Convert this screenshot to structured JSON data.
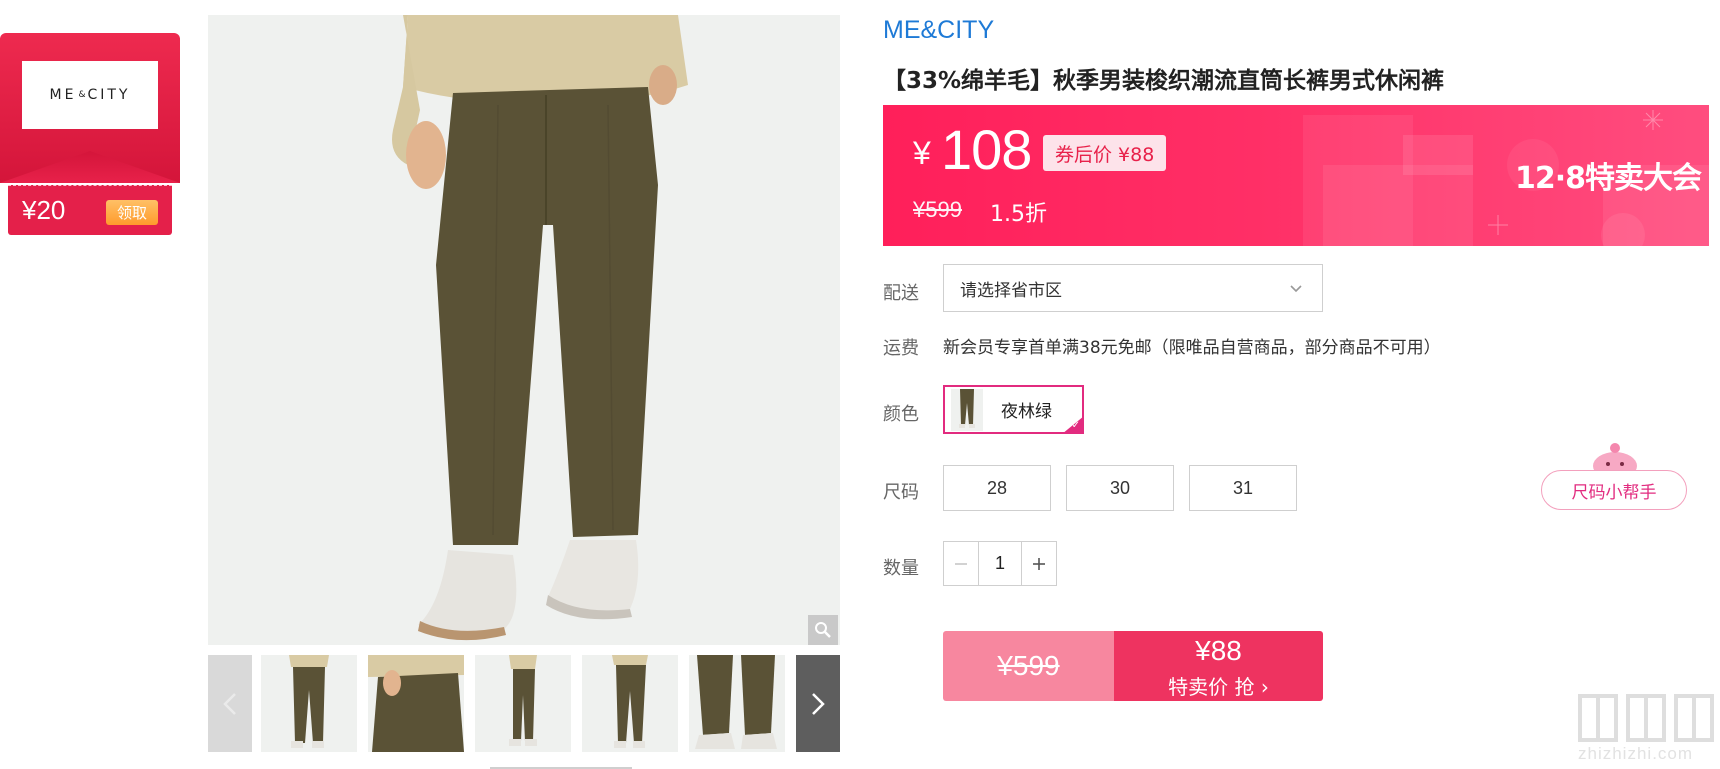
{
  "coupon": {
    "logo_text": "ME & CITY",
    "amount": "¥20",
    "claim_label": "领取"
  },
  "gallery": {
    "main_alt": "olive straight-leg trousers on model",
    "thumb_count": 6
  },
  "product": {
    "brand": "ME&CITY",
    "title": "【33%绵羊毛】秋季男装梭织潮流直筒长裤男式休闲裤"
  },
  "price": {
    "currency": "¥",
    "current": "108",
    "after_coupon": "券后价 ¥88",
    "original": "¥599",
    "discount": "1.5折",
    "event": "12·8特卖大会"
  },
  "labels": {
    "delivery": "配送",
    "shipping": "运费",
    "color": "颜色",
    "size": "尺码",
    "quantity": "数量"
  },
  "delivery": {
    "placeholder": "请选择省市区"
  },
  "shipping": {
    "text": "新会员专享首单满38元免邮（限唯品自营商品，部分商品不可用）"
  },
  "color": {
    "selected": "夜林绿"
  },
  "sizes": [
    "28",
    "30",
    "31"
  ],
  "size_helper": "尺码小帮手",
  "quantity": {
    "value": "1",
    "minus": "−",
    "plus": "+"
  },
  "buy": {
    "original": "¥599",
    "price": "¥88",
    "label": "特卖价 抢 ›"
  },
  "watermark": {
    "site": "zhizhizhi.com"
  },
  "colors": {
    "brand_blue": "#1e7ad6",
    "accent_pink": "#ff1f5a",
    "selected_border": "#e22b7f"
  }
}
